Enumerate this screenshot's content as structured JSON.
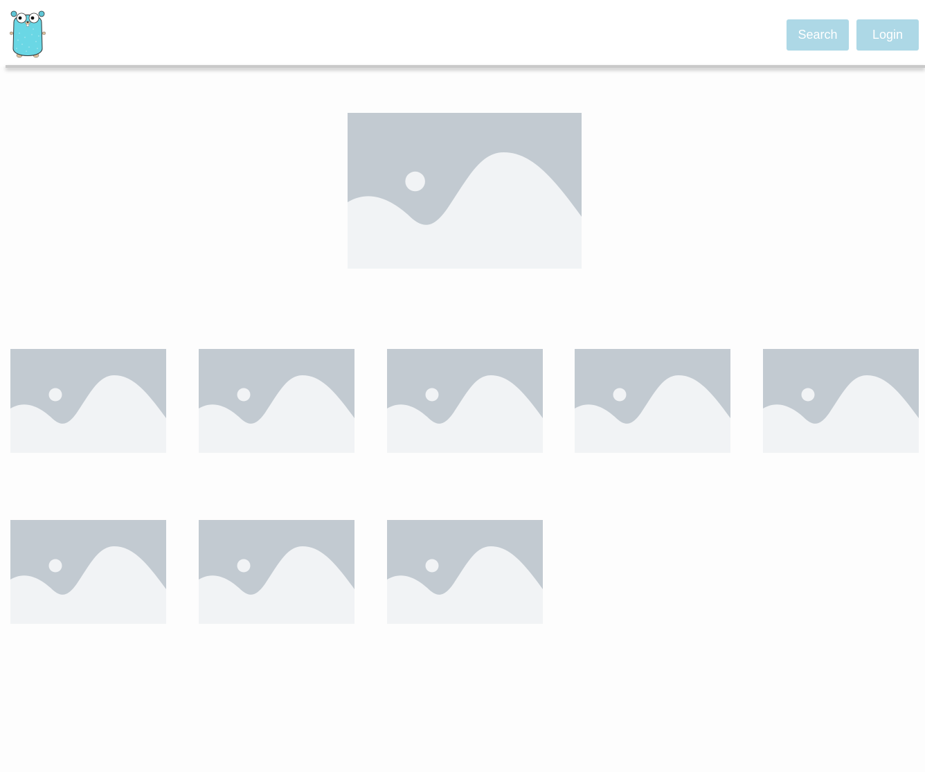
{
  "header": {
    "logo_icon": "gopher-logo-icon",
    "search_label": "Search",
    "login_label": "Login",
    "button_color": "#add8e6"
  },
  "hero": {
    "icon": "image-placeholder-icon"
  },
  "gallery": {
    "item_count": 8,
    "items": [
      {
        "icon": "image-placeholder-icon"
      },
      {
        "icon": "image-placeholder-icon"
      },
      {
        "icon": "image-placeholder-icon"
      },
      {
        "icon": "image-placeholder-icon"
      },
      {
        "icon": "image-placeholder-icon"
      },
      {
        "icon": "image-placeholder-icon"
      },
      {
        "icon": "image-placeholder-icon"
      },
      {
        "icon": "image-placeholder-icon"
      }
    ]
  },
  "colors": {
    "placeholder_bg": "#c2cad1",
    "placeholder_fg": "#f1f3f5"
  }
}
